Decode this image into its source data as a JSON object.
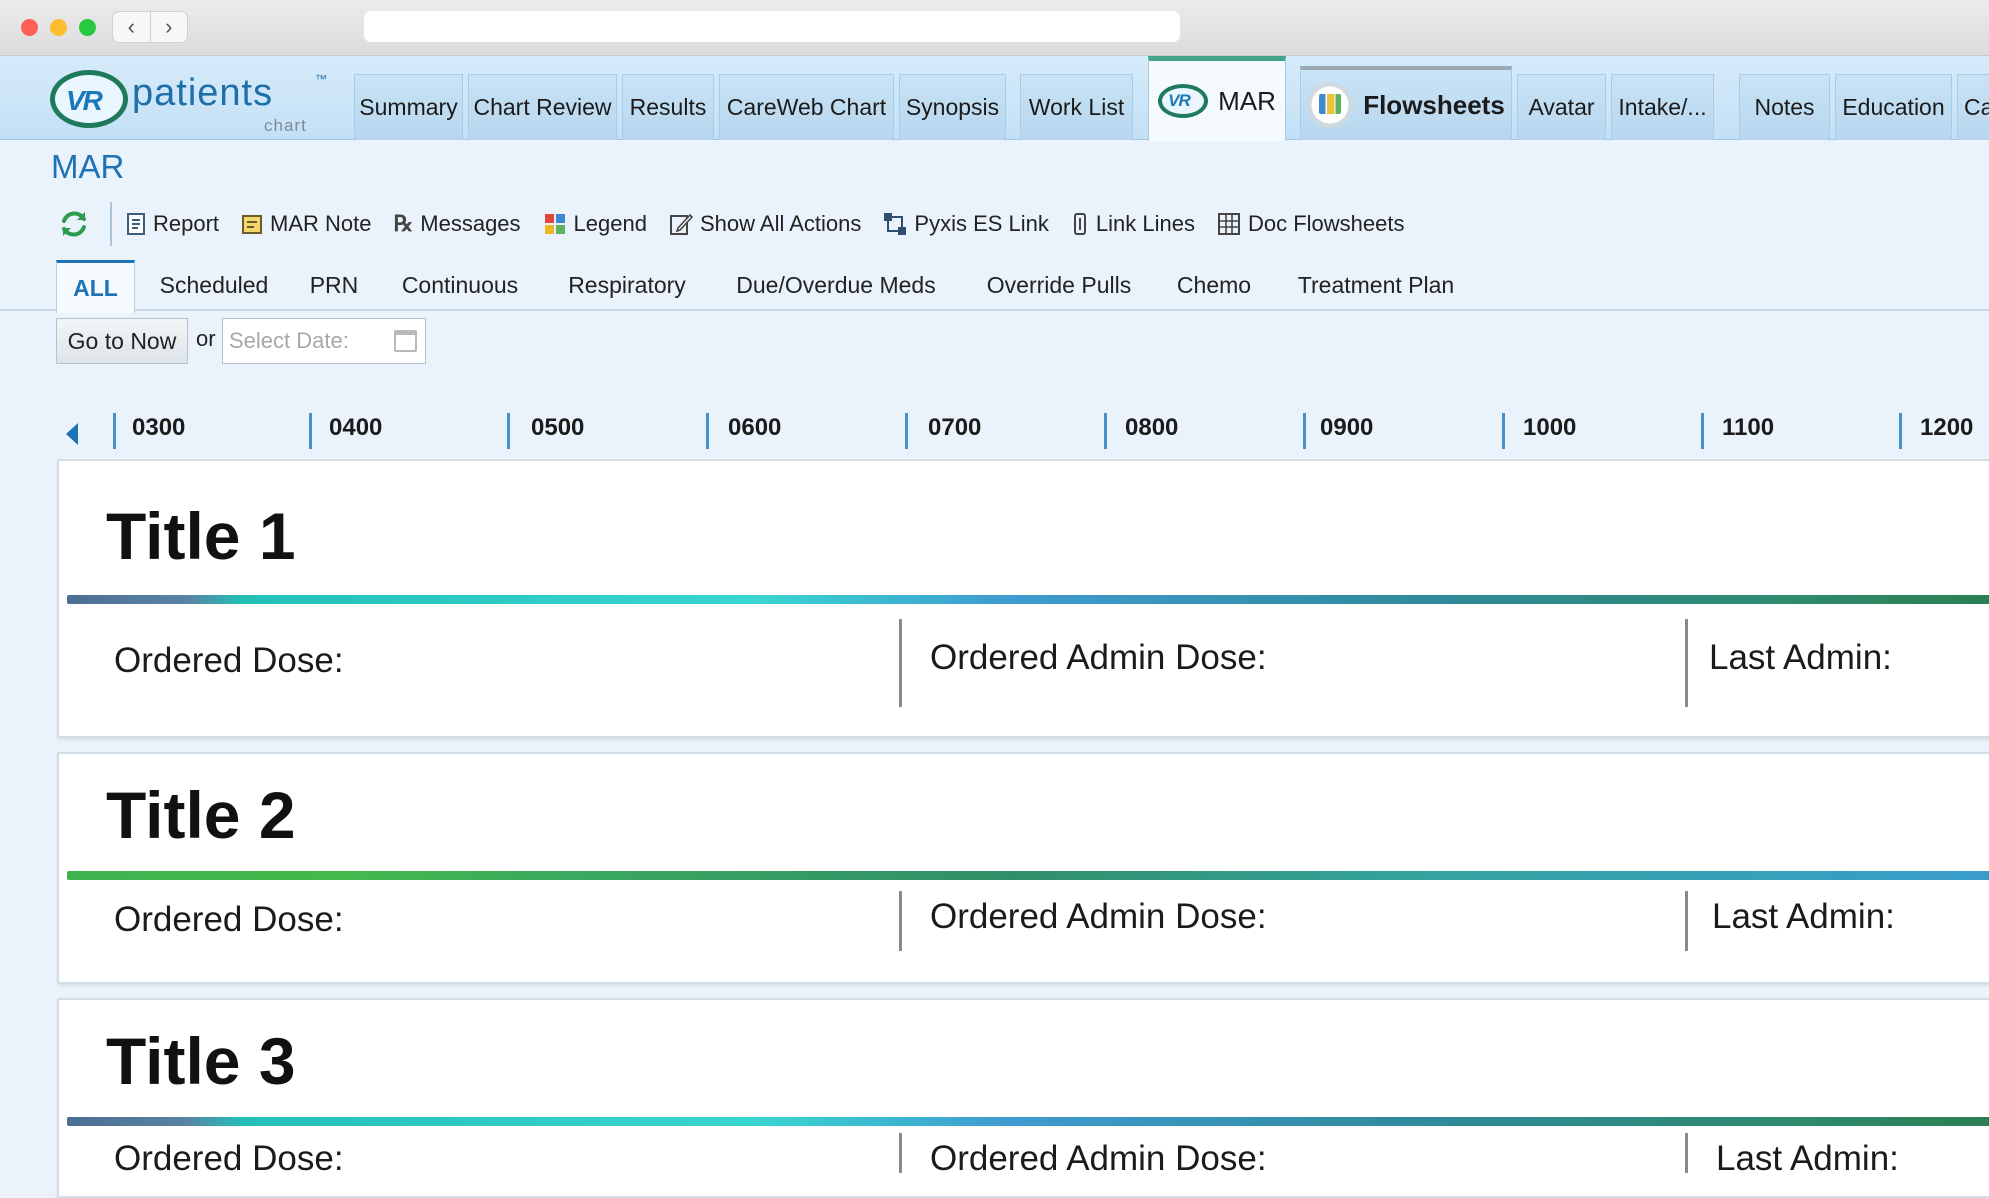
{
  "app": {
    "logo_word": "patients",
    "logo_tm": "™",
    "logo_sub": "chart",
    "logo_mark": "VR"
  },
  "tabs": [
    {
      "label": "Summary"
    },
    {
      "label": "Chart Review"
    },
    {
      "label": "Results"
    },
    {
      "label": "CareWeb Chart"
    },
    {
      "label": "Synopsis"
    },
    {
      "label": "Work List"
    },
    {
      "label": "MAR",
      "active": true,
      "icon": "vr-logo-icon"
    },
    {
      "label": "Flowsheets",
      "icon": "flowsheets-icon"
    },
    {
      "label": "Avatar"
    },
    {
      "label": "Intake/..."
    },
    {
      "label": "Notes"
    },
    {
      "label": "Education"
    },
    {
      "label": "Ca"
    }
  ],
  "page_title": "MAR",
  "toolbar": [
    {
      "label": "Report",
      "icon": "report-icon"
    },
    {
      "label": "MAR Note",
      "icon": "note-icon"
    },
    {
      "label": "Messages",
      "icon": "rx-icon"
    },
    {
      "label": "Legend",
      "icon": "legend-icon"
    },
    {
      "label": "Show All Actions",
      "icon": "pencil-icon"
    },
    {
      "label": "Pyxis ES Link",
      "icon": "link-nodes-icon"
    },
    {
      "label": "Link Lines",
      "icon": "link-lines-icon"
    },
    {
      "label": "Doc Flowsheets",
      "icon": "grid-icon"
    }
  ],
  "filters": [
    {
      "label": "ALL",
      "active": true
    },
    {
      "label": "Scheduled"
    },
    {
      "label": "PRN"
    },
    {
      "label": "Continuous"
    },
    {
      "label": "Respiratory"
    },
    {
      "label": "Due/Overdue Meds"
    },
    {
      "label": "Override Pulls"
    },
    {
      "label": "Chemo"
    },
    {
      "label": "Treatment Plan"
    }
  ],
  "go_to_now": "Go to Now",
  "or_text": "or",
  "date_placeholder": "Select Date:",
  "timeline": [
    "0300",
    "0400",
    "0500",
    "0600",
    "0700",
    "0800",
    "0900",
    "1000",
    "1100",
    "1200"
  ],
  "cards": [
    {
      "title": "Title 1",
      "ordered_dose": "Ordered Dose:",
      "ordered_admin_dose": "Ordered Admin Dose:",
      "last_admin": "Last Admin:"
    },
    {
      "title": "Title 2",
      "ordered_dose": "Ordered Dose:",
      "ordered_admin_dose": "Ordered Admin Dose:",
      "last_admin": "Last Admin:"
    },
    {
      "title": "Title 3",
      "ordered_dose": "Ordered Dose:",
      "ordered_admin_dose": "Ordered Admin Dose:",
      "last_admin": "Last Admin:"
    }
  ],
  "colors": {
    "accent": "#1e73b5",
    "tab_bg": "#c4e0f5",
    "active_tab_top": "#41a58a"
  }
}
